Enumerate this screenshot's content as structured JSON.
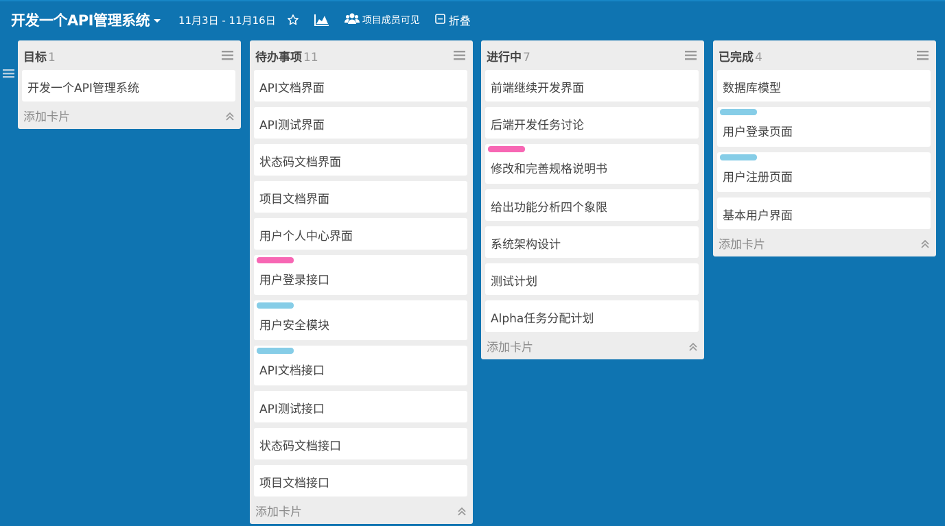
{
  "header": {
    "board_title": "开发一个API管理系统",
    "date_range": "11月3日 - 11月16日",
    "members_label": "项目成员可见",
    "collapse_label": "折叠"
  },
  "colors": {
    "background": "#0f74b1",
    "list_bg": "#ededed",
    "label_pink": "#f767b4",
    "label_blue": "#86cde7"
  },
  "add_card_label": "添加卡片",
  "lists": [
    {
      "title": "目标",
      "count": "1",
      "cards": [
        {
          "text": "开发一个API管理系统",
          "label": ""
        }
      ]
    },
    {
      "title": "待办事项",
      "count": "11",
      "cards": [
        {
          "text": "API文档界面",
          "label": ""
        },
        {
          "text": "API测试界面",
          "label": ""
        },
        {
          "text": "状态码文档界面",
          "label": ""
        },
        {
          "text": "项目文档界面",
          "label": ""
        },
        {
          "text": "用户个人中心界面",
          "label": ""
        },
        {
          "text": "用户登录接口",
          "label": "pink"
        },
        {
          "text": "用户安全模块",
          "label": "blue"
        },
        {
          "text": "API文档接口",
          "label": "blue"
        },
        {
          "text": "API测试接口",
          "label": ""
        },
        {
          "text": "状态码文档接口",
          "label": ""
        },
        {
          "text": "项目文档接口",
          "label": ""
        }
      ]
    },
    {
      "title": "进行中",
      "count": "7",
      "cards": [
        {
          "text": "前端继续开发界面",
          "label": ""
        },
        {
          "text": "后端开发任务讨论",
          "label": ""
        },
        {
          "text": "修改和完善规格说明书",
          "label": "pink"
        },
        {
          "text": "给出功能分析四个象限",
          "label": ""
        },
        {
          "text": "系统架构设计",
          "label": ""
        },
        {
          "text": "测试计划",
          "label": ""
        },
        {
          "text": "Alpha任务分配计划",
          "label": ""
        }
      ]
    },
    {
      "title": "已完成",
      "count": "4",
      "cards": [
        {
          "text": "数据库模型",
          "label": ""
        },
        {
          "text": "用户登录页面",
          "label": "blue"
        },
        {
          "text": "用户注册页面",
          "label": "blue"
        },
        {
          "text": "基本用户界面",
          "label": ""
        }
      ]
    }
  ]
}
